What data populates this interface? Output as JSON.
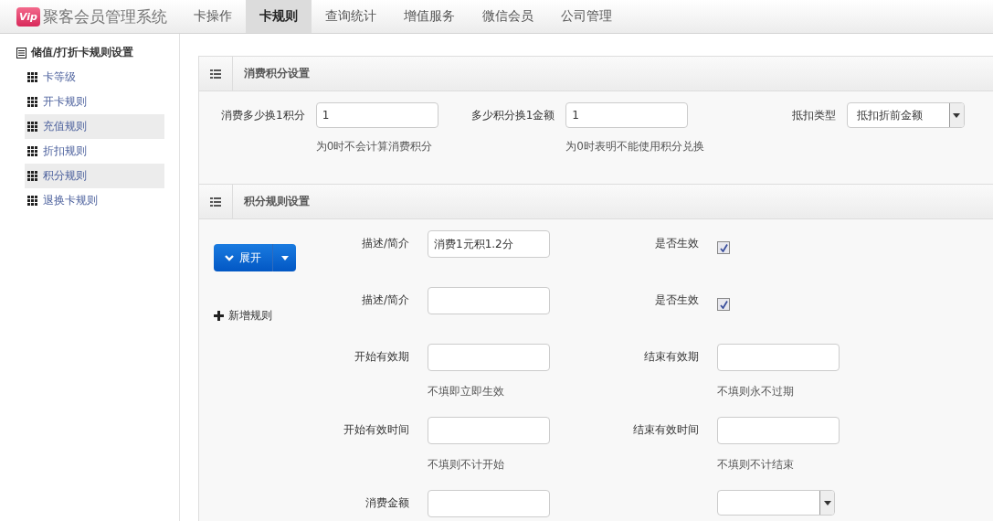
{
  "header": {
    "logo_badge": "Vip",
    "app_name": "聚客会员管理系统"
  },
  "nav_tabs": [
    {
      "label": "卡操作",
      "selected": false
    },
    {
      "label": "卡规则",
      "selected": true
    },
    {
      "label": "查询统计",
      "selected": false
    },
    {
      "label": "增值服务",
      "selected": false
    },
    {
      "label": "微信会员",
      "selected": false
    },
    {
      "label": "公司管理",
      "selected": false
    }
  ],
  "sidebar": {
    "title": "储值/打折卡规则设置",
    "items": [
      {
        "label": "卡等级",
        "selected": false
      },
      {
        "label": "开卡规则",
        "selected": false
      },
      {
        "label": "充值规则",
        "selected": true
      },
      {
        "label": "折扣规则",
        "selected": false
      },
      {
        "label": "积分规则",
        "selected": true
      },
      {
        "label": "退换卡规则",
        "selected": false
      }
    ]
  },
  "points_settings": {
    "title": "消费积分设置",
    "fields": [
      {
        "label": "消费多少换1积分",
        "kind": "text",
        "value": "1",
        "help": "为0时不会计算消费积分"
      },
      {
        "label": "多少积分换1金额",
        "kind": "text",
        "value": "1",
        "help": "为0时表明不能使用积分兑换"
      },
      {
        "label": "抵扣类型",
        "kind": "select",
        "value": "抵扣折前金额"
      }
    ]
  },
  "rule_settings": {
    "title": "积分规则设置",
    "expand_button": "展开",
    "add_rule": "新增规则",
    "rows": [
      [
        {
          "label": "描述/简介",
          "kind": "text",
          "value": "消费1元积1.2分"
        },
        {
          "label": "是否生效",
          "kind": "checkbox",
          "checked": true
        }
      ],
      [
        {
          "label": "描述/简介",
          "kind": "text"
        },
        {
          "label": "是否生效",
          "kind": "checkbox",
          "checked": true
        }
      ],
      [
        {
          "label": "开始有效期",
          "kind": "text",
          "help": "不填即立即生效"
        },
        {
          "label": "结束有效期",
          "kind": "text",
          "help": "不填则永不过期"
        }
      ],
      [
        {
          "label": "开始有效时间",
          "kind": "text",
          "help": "不填则不计开始"
        },
        {
          "label": "结束有效时间",
          "kind": "text",
          "help": "不填则不计结束"
        }
      ],
      [
        {
          "label": "消费金额",
          "kind": "text"
        },
        {
          "kind": "select"
        }
      ]
    ]
  }
}
